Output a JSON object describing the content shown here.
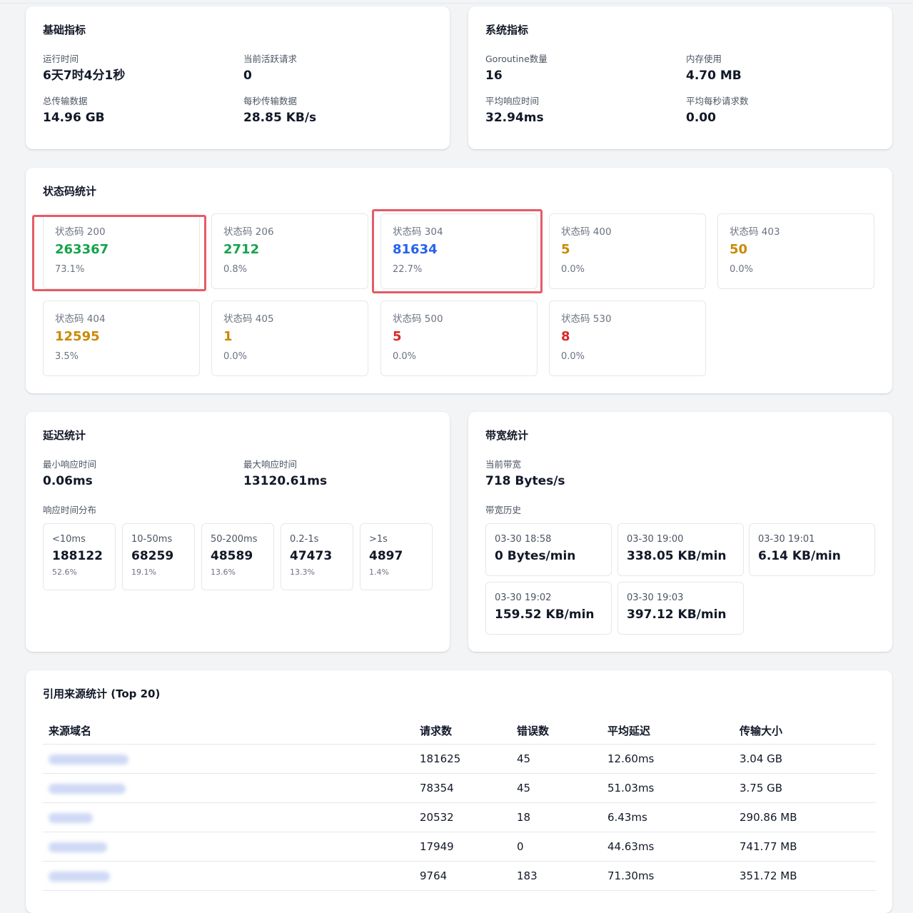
{
  "basic": {
    "title": "基础指标",
    "metrics": [
      {
        "label": "运行时间",
        "value": "6天7时4分1秒"
      },
      {
        "label": "当前活跃请求",
        "value": "0"
      },
      {
        "label": "总传输数据",
        "value": "14.96 GB"
      },
      {
        "label": "每秒传输数据",
        "value": "28.85 KB/s"
      }
    ]
  },
  "system": {
    "title": "系统指标",
    "metrics": [
      {
        "label": "Goroutine数量",
        "value": "16"
      },
      {
        "label": "内存使用",
        "value": "4.70 MB"
      },
      {
        "label": "平均响应时间",
        "value": "32.94ms"
      },
      {
        "label": "平均每秒请求数",
        "value": "0.00"
      }
    ]
  },
  "status": {
    "title": "状态码统计",
    "codes": [
      {
        "label": "状态码 200",
        "count": "263367",
        "pct": "73.1%",
        "color": "#16a34a"
      },
      {
        "label": "状态码 206",
        "count": "2712",
        "pct": "0.8%",
        "color": "#16a34a"
      },
      {
        "label": "状态码 304",
        "count": "81634",
        "pct": "22.7%",
        "color": "#2563eb"
      },
      {
        "label": "状态码 400",
        "count": "5",
        "pct": "0.0%",
        "color": "#ca8a04"
      },
      {
        "label": "状态码 403",
        "count": "50",
        "pct": "0.0%",
        "color": "#ca8a04"
      },
      {
        "label": "状态码 404",
        "count": "12595",
        "pct": "3.5%",
        "color": "#ca8a04"
      },
      {
        "label": "状态码 405",
        "count": "1",
        "pct": "0.0%",
        "color": "#ca8a04"
      },
      {
        "label": "状态码 500",
        "count": "5",
        "pct": "0.0%",
        "color": "#dc2626"
      },
      {
        "label": "状态码 530",
        "count": "8",
        "pct": "0.0%",
        "color": "#dc2626"
      }
    ]
  },
  "latency": {
    "title": "延迟统计",
    "min_label": "最小响应时间",
    "min_value": "0.06ms",
    "max_label": "最大响应时间",
    "max_value": "13120.61ms",
    "dist_label": "响应时间分布",
    "buckets": [
      {
        "label": "<10ms",
        "count": "188122",
        "pct": "52.6%"
      },
      {
        "label": "10-50ms",
        "count": "68259",
        "pct": "19.1%"
      },
      {
        "label": "50-200ms",
        "count": "48589",
        "pct": "13.6%"
      },
      {
        "label": "0.2-1s",
        "count": "47473",
        "pct": "13.3%"
      },
      {
        "label": ">1s",
        "count": "4897",
        "pct": "1.4%"
      }
    ]
  },
  "bandwidth": {
    "title": "带宽统计",
    "current_label": "当前带宽",
    "current_value": "718 Bytes/s",
    "history_label": "带宽历史",
    "history": [
      {
        "time": "03-30 18:58",
        "value": "0 Bytes/min"
      },
      {
        "time": "03-30 19:00",
        "value": "338.05 KB/min"
      },
      {
        "time": "03-30 19:01",
        "value": "6.14 KB/min"
      },
      {
        "time": "03-30 19:02",
        "value": "159.52 KB/min"
      },
      {
        "time": "03-30 19:03",
        "value": "397.12 KB/min"
      }
    ]
  },
  "referers": {
    "title": "引用来源统计 (Top 20)",
    "columns": [
      "来源域名",
      "请求数",
      "错误数",
      "平均延迟",
      "传输大小"
    ],
    "rows": [
      {
        "requests": "181625",
        "errors": "45",
        "latency": "12.60ms",
        "size": "3.04 GB"
      },
      {
        "requests": "78354",
        "errors": "45",
        "latency": "51.03ms",
        "size": "3.75 GB"
      },
      {
        "requests": "20532",
        "errors": "18",
        "latency": "6.43ms",
        "size": "290.86 MB"
      },
      {
        "requests": "17949",
        "errors": "0",
        "latency": "44.63ms",
        "size": "741.77 MB"
      },
      {
        "requests": "9764",
        "errors": "183",
        "latency": "71.30ms",
        "size": "351.72 MB"
      }
    ]
  }
}
